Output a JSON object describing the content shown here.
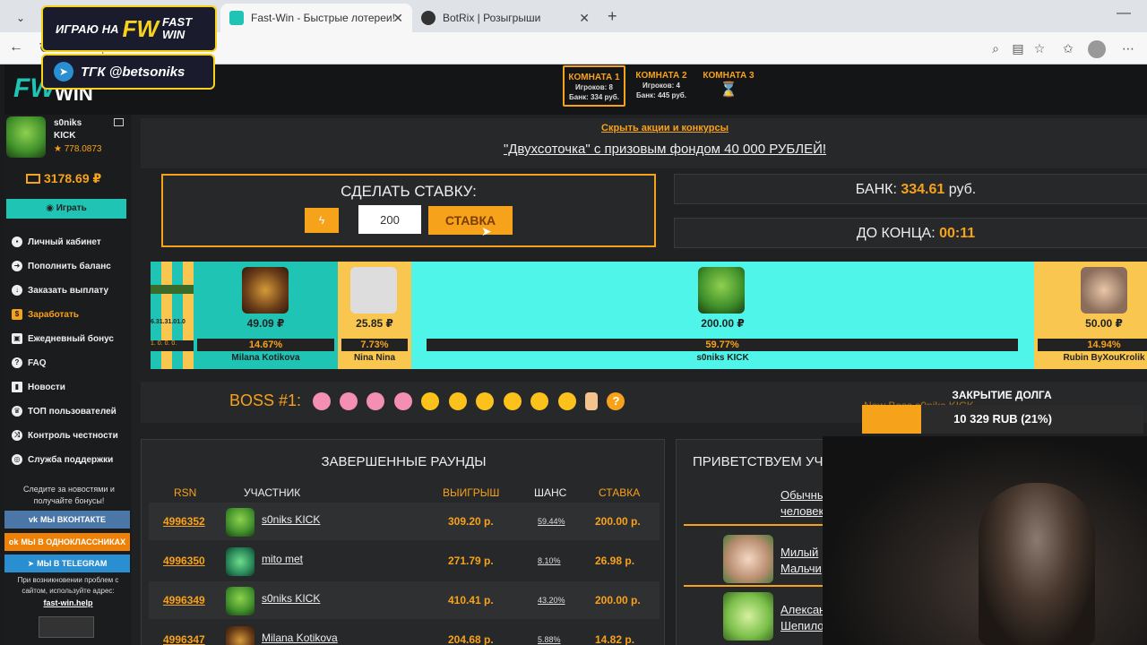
{
  "browser": {
    "tabs": [
      {
        "title": "Fast-Win - Быстрые лотереи! Ком",
        "active": true
      },
      {
        "title": "BotRix | Розыгрыши",
        "active": false
      }
    ],
    "url": "https://fas...room=1"
  },
  "overlays": {
    "badge1_left": "ИГРАЮ НА",
    "badge1_logo": "FW",
    "badge1_right": "FAST WIN",
    "badge2": "ТГК @betsoniks"
  },
  "site": {
    "logo_fw": "FW",
    "logo_win": "WIN",
    "rooms": [
      {
        "title": "КОМНАТА 1",
        "players": "Игроков: 8",
        "bank": "Банк: 334 руб.",
        "active": true
      },
      {
        "title": "КОМНАТА 2",
        "players": "Игроков: 4",
        "bank": "Банк: 445 руб.",
        "active": false
      },
      {
        "title": "КОМНАТА 3",
        "players": "",
        "bank": "",
        "active": false
      }
    ]
  },
  "user": {
    "name": "s0niks",
    "sub": "KICK",
    "rating": "★ 778.0873",
    "balance": "3178.69 ₽",
    "play_button": "Играть"
  },
  "menu": [
    "Личный кабинет",
    "Пополнить баланс",
    "Заказать выплату",
    "Заработать",
    "Ежедневный бонус",
    "FAQ",
    "Новости",
    "ТОП пользователей",
    "Контроль честности",
    "Служба поддержки"
  ],
  "sidebar_bottom": {
    "follow_text": "Следите за новостями и получайте бонусы!",
    "vk": "МЫ ВКОНТАКТЕ",
    "ok": "МЫ В ОДНОКЛАССНИКАХ",
    "tg": "МЫ В TELEGRAM",
    "problem_text": "При возникновении проблем с сайтом, используйте адрес:",
    "help_link": "fast-win.help"
  },
  "promo": {
    "hide_link": "Скрыть акции и конкурсы",
    "headline": "\"Двухсоточка\" с призовым фондом 40 000 РУБЛЕЙ!"
  },
  "bet": {
    "title": "СДЕЛАТЬ СТАВКУ:",
    "amount": "200",
    "button": "СТАВКА",
    "bank_label": "БАНК:",
    "bank_value": "334.61",
    "bank_unit": "руб.",
    "timer_label": "ДО КОНЦА:",
    "timer_value": "00:11"
  },
  "roulette": {
    "mini_chances": "6.31.31.01.0",
    "mini_bars": "1. 0. 0. 0.",
    "players": [
      {
        "amount": "49.09 ₽",
        "chance": "14.67%",
        "name": "Milana Kotikova"
      },
      {
        "amount": "25.85 ₽",
        "chance": "7.73%",
        "name": "Nina Nina"
      },
      {
        "amount": "200.00 ₽",
        "chance": "59.77%",
        "name": "s0niks KICK"
      },
      {
        "amount": "50.00 ₽",
        "chance": "14.94%",
        "name": "Rubin ByXouKrolik"
      }
    ]
  },
  "boss": {
    "label": "BOSS #1:",
    "help": "?"
  },
  "debt": {
    "title": "ЗАКРЫТИЕ ДОЛГА",
    "value": "10 329 RUB (21%)",
    "progress": 0.21,
    "behind_text": "New Boss s0niks KICK"
  },
  "rounds": {
    "title": "ЗАВЕРШЕННЫЕ РАУНДЫ",
    "headers": {
      "rsn": "RSN",
      "user": "УЧАСТНИК",
      "win": "ВЫИГРЫШ",
      "chance": "ШАНС",
      "bet": "СТАВКА"
    },
    "rows": [
      {
        "rsn": "4996352",
        "name": "s0niks KICK",
        "win": "309.20 р.",
        "chance": "59.44%",
        "bet": "200.00 р."
      },
      {
        "rsn": "4996350",
        "name": "mito met",
        "win": "271.79 р.",
        "chance": "8.10%",
        "bet": "26.98 р."
      },
      {
        "rsn": "4996349",
        "name": "s0niks KICK",
        "win": "410.41 р.",
        "chance": "43.20%",
        "bet": "200.00 р."
      },
      {
        "rsn": "4996347",
        "name": "Milana Kotikova",
        "win": "204.68 р.",
        "chance": "5.88%",
        "bet": "14.82 р."
      }
    ]
  },
  "welcome": {
    "title": "ПРИВЕТСТВУЕМ УЧ",
    "items": [
      {
        "l1": "Обычны",
        "l2": "человек"
      },
      {
        "l1": "Милый",
        "l2": "Мальчи"
      },
      {
        "l1": "Алексан",
        "l2": "Шепило"
      }
    ]
  },
  "colors": {
    "accent": "#f7a21b",
    "teal": "#1fc4b5",
    "cyan": "#4ef5e8",
    "yellow": "#f9c74f"
  }
}
